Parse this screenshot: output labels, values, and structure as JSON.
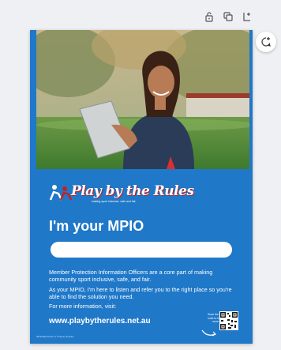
{
  "toolbar": {
    "icons": [
      "lock-icon",
      "duplicate-icon",
      "add-page-icon"
    ]
  },
  "side_button": {
    "icon": "add-comment-icon"
  },
  "poster": {
    "brand_name": "Play by the Rules",
    "brand_tagline": "making sport inclusive, safe and fair.",
    "heading": "I'm your MPIO",
    "paragraph1": "Member Protection Information Officers are a core part of making community sport inclusive, safe, and fair.",
    "paragraph2": "As your MPIO, I'm here to listen and refer you to the right place so you're able to find the solution you need.",
    "paragraph3": "For more information, visit:",
    "url": "www.playbytherules.net.au",
    "scan_text": "Scan the QR code to learn more",
    "fine_print": "PBTR MPIO Poster v1 © Play by the Rules"
  },
  "colors": {
    "poster_blue": "#1f78c8",
    "brand_red": "#c8201f",
    "canvas_bg": "#eef0f3"
  }
}
